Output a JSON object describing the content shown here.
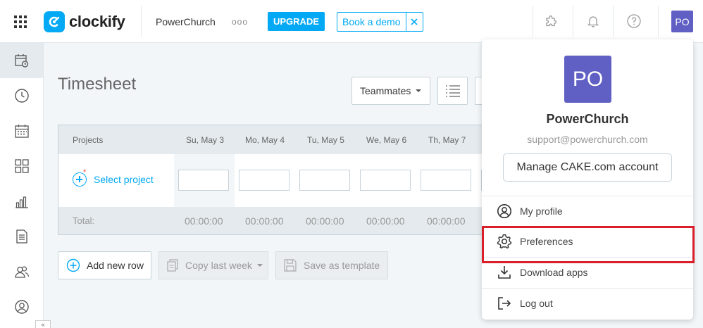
{
  "topbar": {
    "logo_text": "clockify",
    "workspace": "PowerChurch",
    "more": "ooo",
    "upgrade_label": "UPGRADE",
    "book_demo_label": "Book a demo",
    "avatar_initials": "PO"
  },
  "sidebar": {
    "items": [
      "timesheet",
      "time-tracker",
      "calendar",
      "dashboard",
      "reports",
      "projects",
      "team",
      "clients"
    ]
  },
  "main": {
    "title": "Timesheet",
    "teammates_label": "Teammates",
    "table": {
      "project_header": "Projects",
      "days": [
        "Su, May 3",
        "Mo, May 4",
        "Tu, May 5",
        "We, May 6",
        "Th, May 7"
      ],
      "select_project": "Select project",
      "required_mark": "*",
      "total_label": "Total:",
      "totals": [
        "00:00:00",
        "00:00:00",
        "00:00:00",
        "00:00:00",
        "00:00:00"
      ]
    },
    "buttons": {
      "add_row": "Add new row",
      "copy_week": "Copy last week",
      "save_template": "Save as template"
    }
  },
  "dropdown": {
    "avatar_initials": "PO",
    "name": "PowerChurch",
    "email": "support@powerchurch.com",
    "manage_label": "Manage CAKE.com account",
    "items": [
      {
        "label": "My profile",
        "icon": "user-circle-icon"
      },
      {
        "label": "Preferences",
        "icon": "gear-icon"
      },
      {
        "label": "Download apps",
        "icon": "download-icon"
      },
      {
        "label": "Log out",
        "icon": "logout-icon"
      }
    ]
  },
  "colors": {
    "accent": "#03a9f4",
    "avatar": "#5f5fc4",
    "highlight": "#d9202a"
  }
}
